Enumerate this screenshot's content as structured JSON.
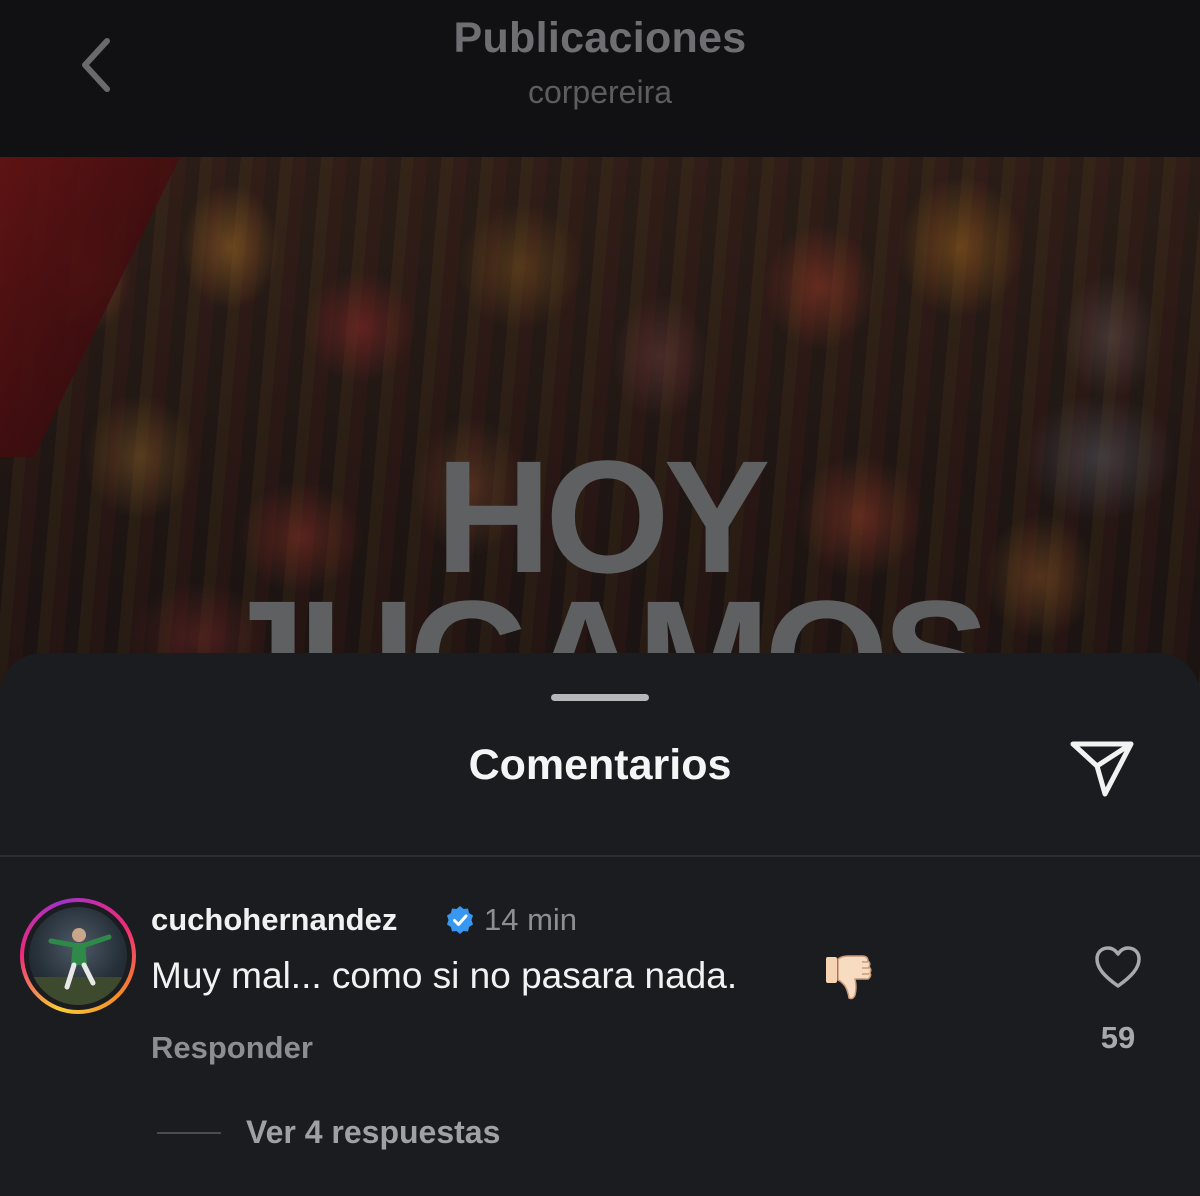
{
  "header": {
    "title": "Publicaciones",
    "subtitle": "corpereira",
    "back_icon": "chevron-left-icon"
  },
  "post": {
    "overlay_text": "HOY\nJUGAMOS"
  },
  "comments_sheet": {
    "title": "Comentarios",
    "share_icon": "paper-plane-icon"
  },
  "comment": {
    "username": "cuchohernandez",
    "verified": true,
    "timestamp": "14 min",
    "text": "Muy mal... como si no pasara nada.",
    "emoji": "thumbs-down",
    "reply_label": "Responder",
    "like_count": "59",
    "view_replies_label": "Ver 4 respuestas"
  },
  "colors": {
    "background": "#0c0c0e",
    "sheet": "#1b1c20",
    "verified_badge": "#3897f0"
  }
}
